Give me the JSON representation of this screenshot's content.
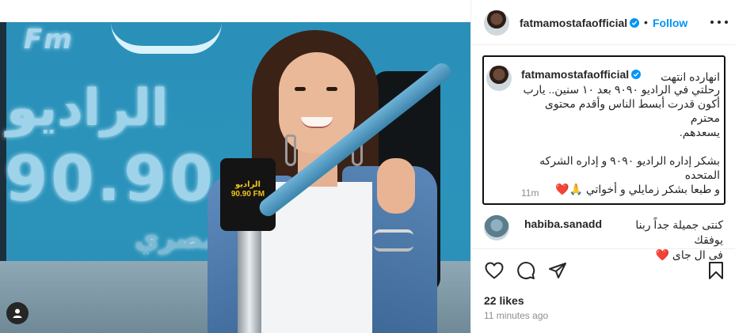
{
  "post": {
    "author": "fatmamostafaofficial",
    "follow_label": "Follow",
    "dot": "•",
    "caption": {
      "line1": "انهارده انتهت",
      "line2": "رحلتي في الراديو ٩٠٩٠ بعد ١٠ سنين.. يارب",
      "line3": "أكون قدرت أبسط الناس وأقدم محتوى محترم",
      "line4": "يسعدهم.",
      "line5": "بشكر إداره الراديو ٩٠٩٠ و إداره الشركه",
      "line6": "المتحده",
      "line7": "و طبعا بشكر زمايلي و أخواتي 🙏❤️",
      "time": "11m"
    },
    "comment": {
      "user": "habiba.sanadd",
      "text1": "كنتى جميلة جداً ربنا يوفقك",
      "text2": "فى ال جاى ❤️"
    },
    "likes": "22 likes",
    "posted_ago": "11 minutes ago"
  },
  "photo": {
    "sign_fm": "Fm",
    "sign_radio": "الراديو",
    "sign_number": "90.90",
    "sign_tagline": "مصري",
    "mic_logo": "الراديو 90.90 FM"
  },
  "icons": {
    "more": "more-options-icon",
    "verified": "verified-badge-icon",
    "like": "heart-outline-icon",
    "comment": "comment-bubble-icon",
    "share": "paper-plane-icon",
    "save": "bookmark-icon",
    "tagged_users": "user-tag-icon"
  },
  "colors": {
    "accent": "#0095f6",
    "text": "#262626",
    "muted": "#8e8e8e"
  }
}
